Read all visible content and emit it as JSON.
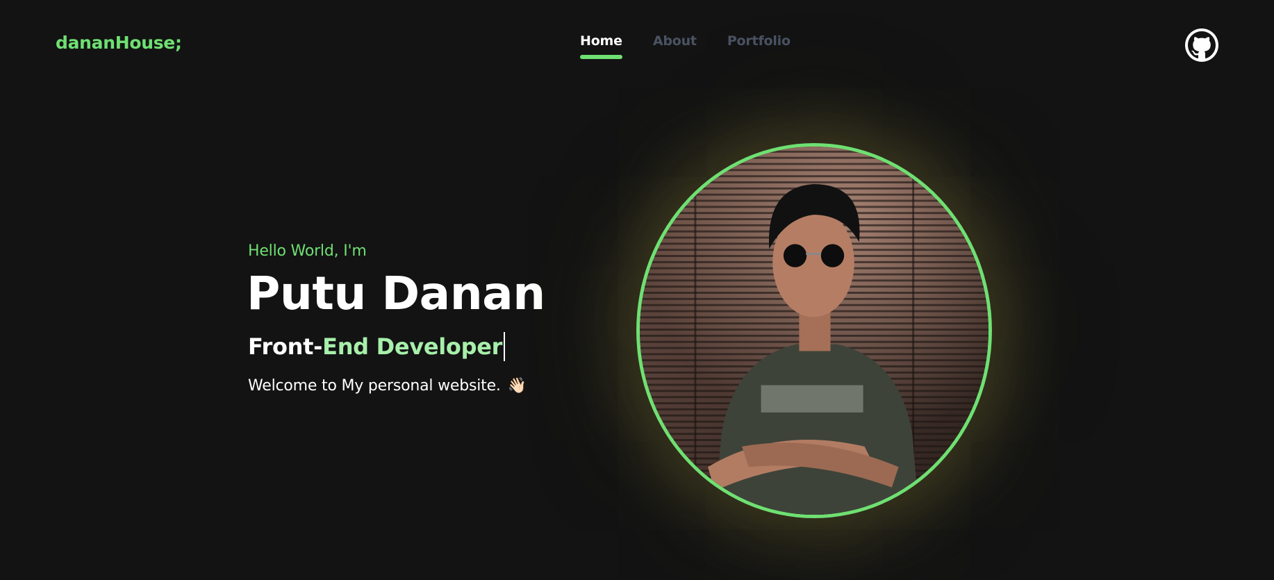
{
  "header": {
    "logo": "dananHouse;",
    "nav": [
      {
        "label": "Home",
        "active": true
      },
      {
        "label": "About",
        "active": false
      },
      {
        "label": "Portfolio",
        "active": false
      }
    ],
    "github_icon": "github-icon"
  },
  "hero": {
    "greeting": "Hello World, I'm",
    "name": "Putu Danan",
    "role_part1": "Front-",
    "role_part2": "End Developer",
    "welcome": "Welcome to My personal website.",
    "wave_emoji": "👋🏻"
  },
  "colors": {
    "background": "#131313",
    "accent": "#6fe072",
    "nav_inactive": "#4a5363",
    "role_highlight": "#a7efaa"
  }
}
